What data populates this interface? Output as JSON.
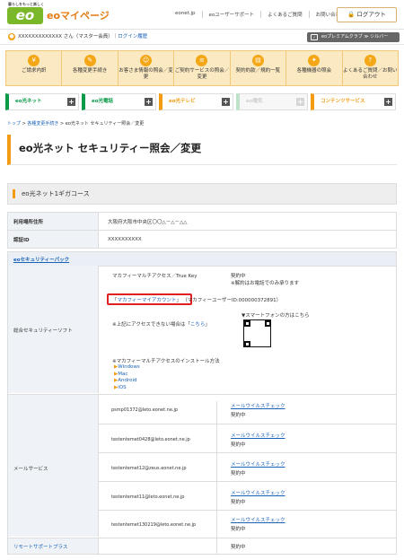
{
  "header": {
    "logo_tagline": "暮らしをもっと楽しく",
    "logo_text": "eo",
    "mypage_label": "eoマイページ",
    "links": [
      "eonet.jp",
      "eoユーザーサポート",
      "よくあるご質問",
      "お問い合わせ"
    ],
    "login_button": "ログアウト"
  },
  "userbar": {
    "icon": "user-icon",
    "name_text": "XXXXXXXXXXXXX さん（マスター会員）",
    "login_history_link": "ログイン履歴",
    "premium_label": "eoプレミアムクラブ ≫ シルバー"
  },
  "iconbar": [
    {
      "icon": "yen-icon",
      "label": "ご請求内訳"
    },
    {
      "icon": "pencil-icon",
      "label": "各種変更手続き"
    },
    {
      "icon": "person-icon",
      "label": "お客さま情報の照会／変更"
    },
    {
      "icon": "list-icon",
      "label": "ご契約サービスの照会／変更"
    },
    {
      "icon": "document-icon",
      "label": "契約約款／規約一覧"
    },
    {
      "icon": "tools-icon",
      "label": "各種機器の照会"
    },
    {
      "icon": "question-icon",
      "label": "よくあるご質問／お問い合わせ"
    }
  ],
  "service_tabs": [
    "eo光ネット",
    "eo光電話",
    "eo光テレビ",
    "eo電気",
    "コンテンツサービス"
  ],
  "breadcrumb": [
    "トップ",
    "各種変更手続き",
    "eo光ネット セキュリティー照会／変更"
  ],
  "page_title": "eo光ネット セキュリティー照会／変更",
  "course_name": "eo光ネット1ギガコース",
  "basic": {
    "address_label": "利用場所住所",
    "address_value": "大阪府大阪市中央区〇〇△－△－△△",
    "auth_label": "認証ID",
    "auth_value": "XXXXXXXXXX"
  },
  "security_pack_link": "eoセキュリティーパック",
  "total_security": {
    "label": "総合セキュリティーソフト",
    "product": "マカフィーマルチアクセス／True Key",
    "status": "契約中",
    "cancel_note": "※解約はお電話でのみ承ります",
    "account_link_prefix": "「",
    "account_link": "マカフィーマイアカウント",
    "account_link_suffix": "」",
    "user_id_text": "（マカフィーユーザーID:000000372891）",
    "access_note_prefix": "※上記にアクセスできない場合は「",
    "access_note_link": "こちら",
    "access_note_suffix": "」",
    "smartphone_label": "▼スマートフォンの方はこちら",
    "install_note": "※マカフィーマルチアクセスのインストール方法",
    "os_links": [
      "Windows",
      "Mac",
      "Android",
      "iOS"
    ]
  },
  "mail_service": {
    "label": "メールサービス",
    "check_link": "メールウイルスチェック",
    "status": "契約中",
    "accounts": [
      "psmp01372@leto.eonet.ne.jp",
      "testentemet0428@leto.eonet.ne.jp",
      "testentemet12@zeus.eonet.ne.jp",
      "testentemet11@leto.eonet.ne.jp",
      "testentemet130219@leto.eonet.ne.jp"
    ]
  },
  "remote_support": {
    "label": "リモートサポートプラス",
    "status": "契約中"
  }
}
